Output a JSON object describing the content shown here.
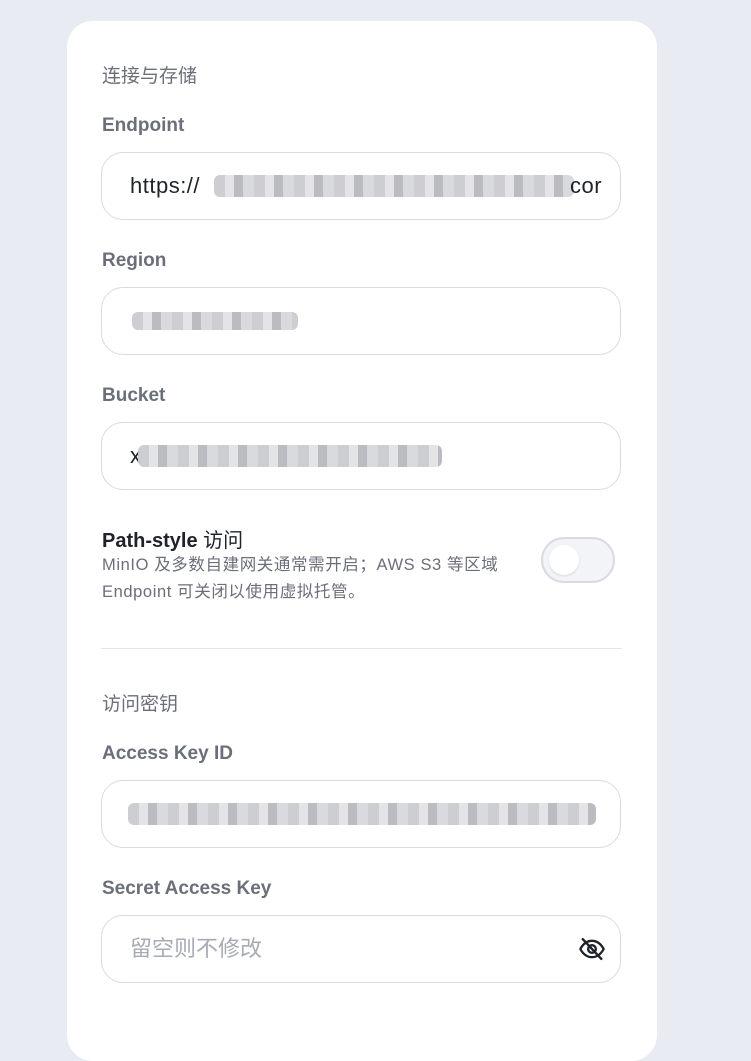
{
  "sections": {
    "connection_title": "连接与存储",
    "keys_title": "访问密钥"
  },
  "fields": {
    "endpoint": {
      "label": "Endpoint",
      "value_prefix": "https://",
      "value_suffix": "cor"
    },
    "region": {
      "label": "Region"
    },
    "bucket": {
      "label": "Bucket",
      "value_prefix": "x"
    },
    "access_key_id": {
      "label": "Access Key ID"
    },
    "secret_access_key": {
      "label": "Secret Access Key",
      "placeholder": "留空则不修改"
    }
  },
  "path_style": {
    "title": "Path-style",
    "title_cjk": "访问",
    "description": "MinIO 及多数自建网关通常需开启；AWS S3 等区域 Endpoint 可关闭以使用虚拟托管。",
    "enabled": false
  },
  "icons": {
    "visibility_toggle": "eye-off-icon"
  },
  "colors": {
    "background": "#e8ebf2",
    "card": "#ffffff",
    "label": "#6b6f7a",
    "text": "#1f2329"
  }
}
